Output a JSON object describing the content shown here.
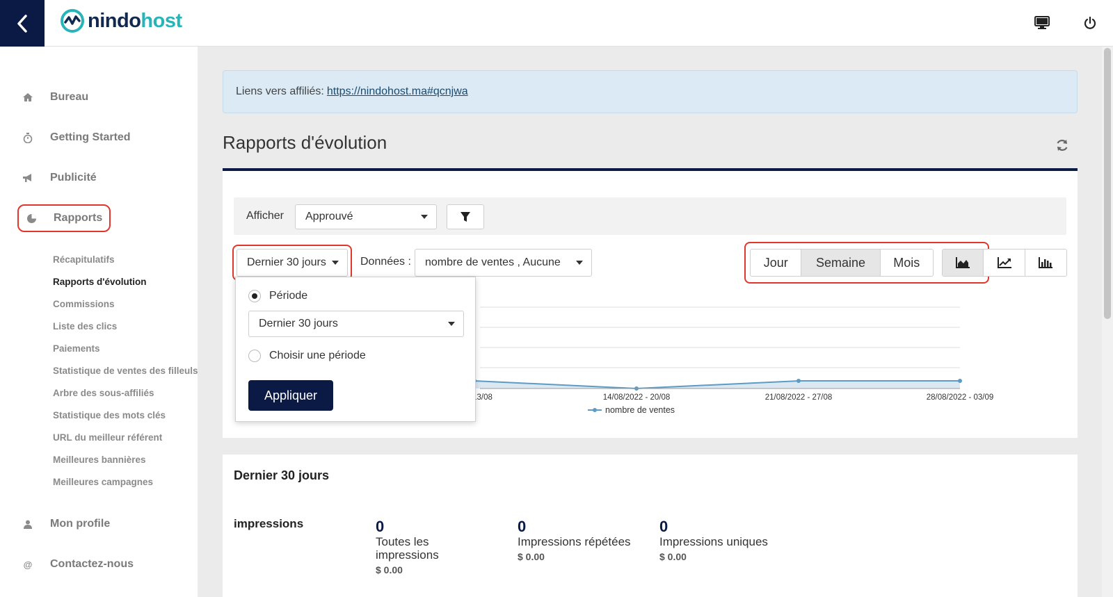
{
  "brand": {
    "part1": "nindo",
    "part2": "host"
  },
  "sidebar": {
    "items": [
      {
        "label": "Bureau",
        "icon": "home-icon"
      },
      {
        "label": "Getting Started",
        "icon": "stopwatch-icon"
      },
      {
        "label": "Publicité",
        "icon": "bullhorn-icon"
      },
      {
        "label": "Rapports",
        "icon": "pie-chart-icon"
      },
      {
        "label": "Mon profile",
        "icon": "user-icon"
      },
      {
        "label": "Contactez-nous",
        "icon": "at-icon"
      }
    ],
    "subitems": [
      "Récapitulatifs",
      "Rapports d'évolution",
      "Commissions",
      "Liste des clics",
      "Paiements",
      "Statistique de ventes des filleuls",
      "Arbre des sous-affiliés",
      "Statistique des mots clés",
      "URL du meilleur référent",
      "Meilleures bannières",
      "Meilleures campagnes"
    ]
  },
  "alert": {
    "prefix": "Liens vers affiliés:",
    "link": "https://nindohost.ma#qcnjwa"
  },
  "page": {
    "title": "Rapports d'évolution"
  },
  "filters": {
    "afficher_label": "Afficher",
    "status_value": "Approuvé",
    "period_value": "Dernier 30 jours",
    "donnees_label": "Données :",
    "donnees_value": "nombre de ventes , Aucune"
  },
  "granularity": {
    "day": "Jour",
    "week": "Semaine",
    "month": "Mois",
    "active": "Semaine"
  },
  "chart_types": [
    "area-chart-icon",
    "line-chart-icon",
    "bar-chart-icon"
  ],
  "popup": {
    "option1": "Période",
    "select_value": "Dernier 30 jours",
    "option2": "Choisir une période",
    "apply": "Appliquer"
  },
  "chart_data": {
    "type": "area",
    "categories": [
      "22 - 13/08",
      "14/08/2022 - 20/08",
      "21/08/2022 - 27/08",
      "28/08/2022 - 03/09"
    ],
    "series": [
      {
        "name": "nombre de ventes",
        "values": [
          0,
          0,
          0,
          0
        ]
      }
    ],
    "grid": true,
    "legend": "bottom"
  },
  "stats": {
    "title": "Dernier 30 jours",
    "row_label": "impressions",
    "items": [
      {
        "value": "0",
        "label": "Toutes les impressions",
        "amount": "$ 0.00"
      },
      {
        "value": "0",
        "label": "Impressions répétées",
        "amount": "$ 0.00"
      },
      {
        "value": "0",
        "label": "Impressions uniques",
        "amount": "$ 0.00"
      }
    ]
  },
  "colors": {
    "navy": "#0b1a45",
    "teal": "#28b4b8",
    "highlight": "#e0362b",
    "series": "#5b9bc4"
  }
}
